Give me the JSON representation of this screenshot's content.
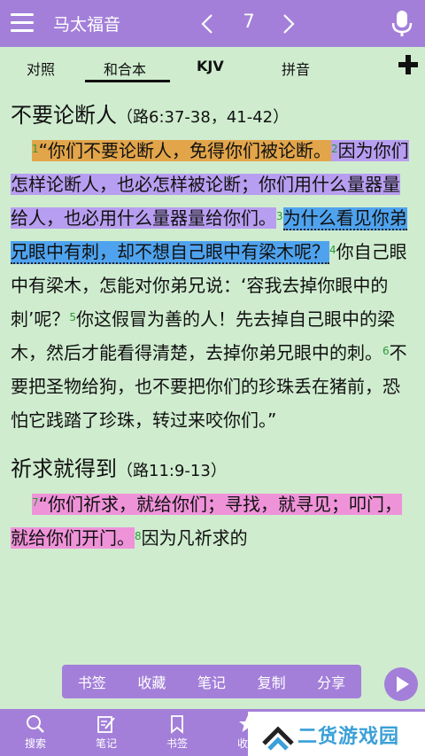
{
  "header": {
    "book_title": "马太福音",
    "chapter": "7"
  },
  "tabs": [
    {
      "label": "对照"
    },
    {
      "label": "和合本"
    },
    {
      "label": "KJV"
    },
    {
      "label": "拼音"
    }
  ],
  "section1": {
    "title": "不要论断人",
    "ref": "（路6:37-38，41-42）",
    "v1_num": "1",
    "v1": "“你们不要论断人，免得你们被论断。",
    "v2_num": "2",
    "v2": "因为你们怎样论断人，也必怎样被论断；你们用什么量器量给人，也必用什么量器量给你们。",
    "v3_num": "3",
    "v3": "为什么看见你弟兄眼中有刺，却不想自己眼中有梁木呢？",
    "v4_num": "4",
    "v4": "你自己眼中有梁木，怎能对你弟兄说：‘容我去掉你眼中的刺’呢？",
    "v5_num": "5",
    "v5": "你这假冒为善的人！先去掉自己眼中的梁木，然后才能看得清楚，去掉你弟兄眼中的刺。",
    "v6_num": "6",
    "v6": "不要把圣物给狗，也不要把你们的珍珠丢在猪前，恐怕它践踏了珍珠，转过来咬你们。”"
  },
  "section2": {
    "title": "祈求就得到",
    "ref": "（路11:9-13）",
    "v7_num": "7",
    "v7": "“你们祈求，就给你们；寻找，就寻见；叩门，就给你们开门。",
    "v8_num": "8",
    "v8": "因为凡祈求的"
  },
  "popup_menu": [
    "书签",
    "收藏",
    "笔记",
    "复制",
    "分享"
  ],
  "bottom_nav": [
    "搜索",
    "笔记",
    "书签",
    "收藏"
  ],
  "watermark": {
    "text": "二货游戏园"
  },
  "colors": {
    "accent": "#a37fd9",
    "background": "#cfeccf",
    "hl_orange": "#e2a54a",
    "hl_purple": "#b89ef0",
    "hl_blue": "#4fa3ee",
    "hl_pink": "#ef93d9"
  }
}
